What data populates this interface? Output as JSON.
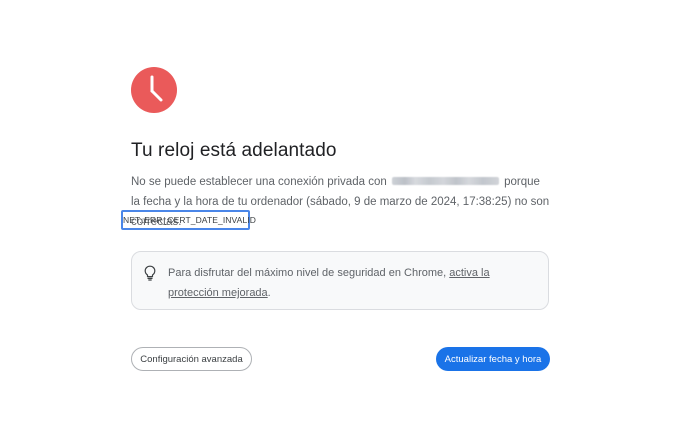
{
  "icon": {
    "name": "clock-icon",
    "color": "#ea5a5a"
  },
  "title": "Tu reloj está adelantado",
  "description": {
    "before_domain": "No se puede establecer una conexión privada con",
    "after_domain": "porque la fecha y la hora de tu ordenador (sábado, 9 de marzo de 2024, 17:38:25) no son correctas."
  },
  "error_code": "NET::ERR_CERT_DATE_INVALID",
  "info_card": {
    "icon": "lightbulb-icon",
    "text": "Para disfrutar del máximo nivel de seguridad en Chrome, ",
    "link": "activa la protección mejorada",
    "suffix": "."
  },
  "buttons": {
    "advanced": "Configuración avanzada",
    "update": "Actualizar fecha y hora"
  },
  "colors": {
    "primary": "#1a73e8",
    "focus_outline": "#4a86e8",
    "text_secondary": "#5f6368"
  }
}
